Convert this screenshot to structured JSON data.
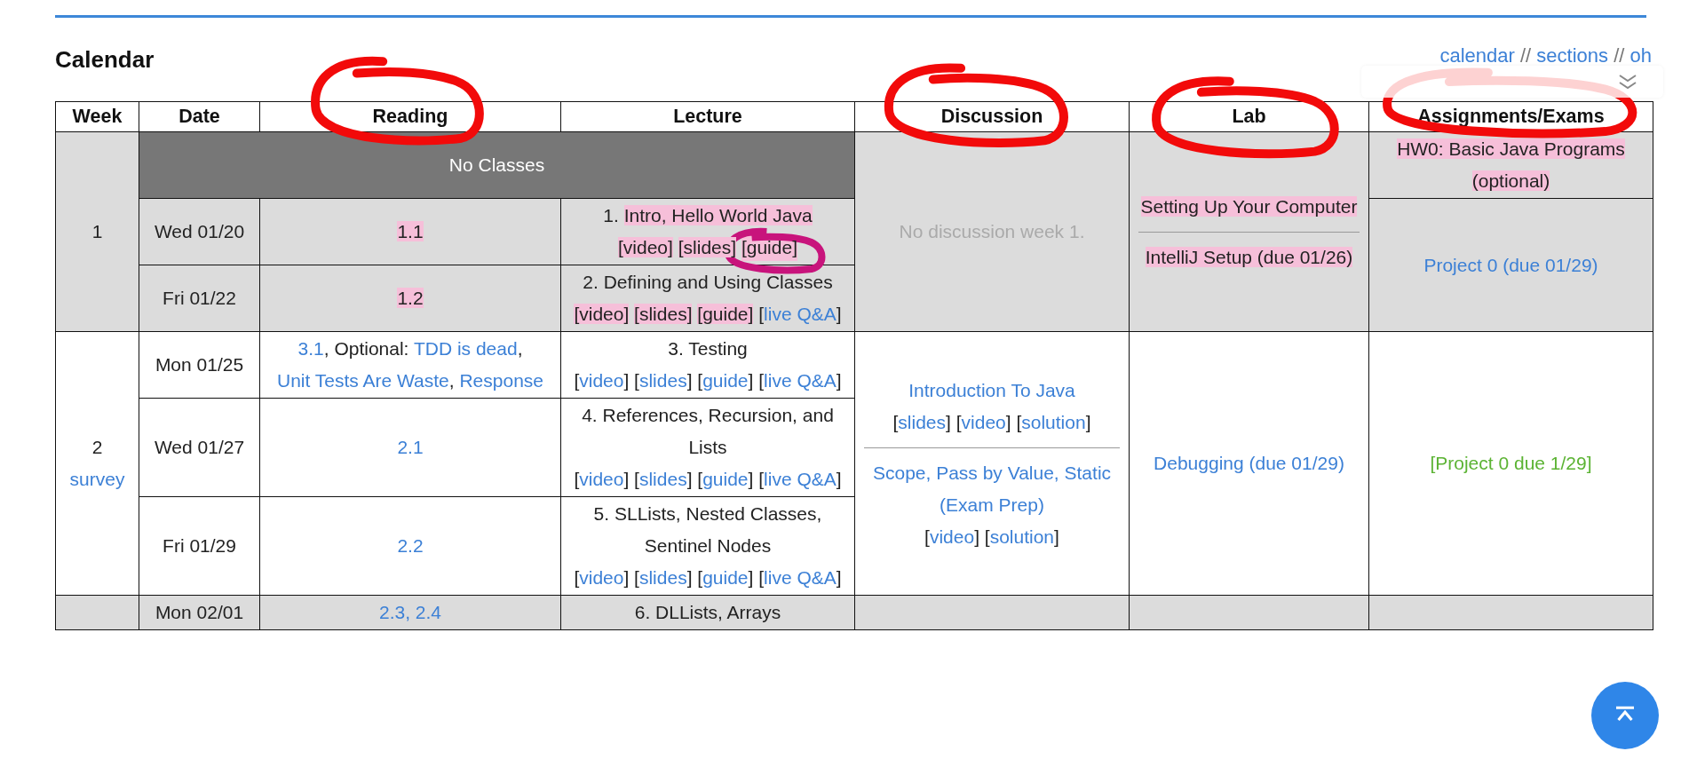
{
  "page": {
    "title": "Calendar",
    "nav": [
      {
        "text": "calendar",
        "kind": "link"
      },
      {
        "text": " // ",
        "kind": "text"
      },
      {
        "text": "sections",
        "kind": "link"
      },
      {
        "text": " // ",
        "kind": "text"
      },
      {
        "text": "oh",
        "kind": "link"
      }
    ]
  },
  "table": {
    "columns": [
      {
        "label": "Week",
        "circled": false
      },
      {
        "label": "Date",
        "circled": false
      },
      {
        "label": "Reading",
        "circled": true
      },
      {
        "label": "Lecture",
        "circled": false
      },
      {
        "label": "Discussion",
        "circled": true
      },
      {
        "label": "Lab",
        "circled": true
      },
      {
        "label": "Assignments/Exams",
        "circled": true
      }
    ],
    "weeks": [
      {
        "shaded": true,
        "week": [
          {
            "kind": "text",
            "parts": [
              {
                "text": "1",
                "kind": "text"
              }
            ]
          }
        ],
        "banner": "No Classes",
        "days": [
          {
            "date": "Wed 01/20",
            "reading": [
              {
                "kind": "text",
                "parts": [
                  {
                    "text": "1.1",
                    "kind": "marked"
                  }
                ]
              }
            ],
            "lecture": [
              {
                "kind": "text",
                "parts": [
                  {
                    "text": "1. ",
                    "kind": "text"
                  },
                  {
                    "text": "Intro, Hello World Java",
                    "kind": "marked"
                  }
                ]
              },
              {
                "kind": "text",
                "parts": [
                  {
                    "text": "[video]",
                    "kind": "marked"
                  },
                  {
                    "text": "[slides]",
                    "kind": "marked"
                  },
                  {
                    "text": "[guide]",
                    "kind": "circled"
                  }
                ]
              }
            ]
          },
          {
            "date": "Fri 01/22",
            "reading": [
              {
                "kind": "text",
                "parts": [
                  {
                    "text": "1.2",
                    "kind": "marked"
                  }
                ]
              }
            ],
            "lecture": [
              {
                "kind": "text",
                "parts": [
                  {
                    "text": "2. Defining and Using Classes",
                    "kind": "text"
                  }
                ]
              },
              {
                "kind": "text",
                "parts": [
                  {
                    "text": "[video]",
                    "kind": "marked"
                  },
                  {
                    "text": "[slides]",
                    "kind": "marked"
                  },
                  {
                    "text": "[guide]",
                    "kind": "marked"
                  },
                  {
                    "text": "[",
                    "kind": "text"
                  },
                  {
                    "text": "live Q&A",
                    "kind": "link"
                  },
                  {
                    "text": "]",
                    "kind": "text"
                  }
                ]
              }
            ]
          }
        ],
        "discussion": [
          {
            "kind": "text",
            "parts": [
              {
                "text": "No discussion week 1.",
                "kind": "muted"
              }
            ]
          }
        ],
        "lab": [
          {
            "kind": "text",
            "parts": [
              {
                "text": "Setting Up Your Computer",
                "kind": "marked"
              }
            ]
          },
          {
            "kind": "rule"
          },
          {
            "kind": "text",
            "parts": [
              {
                "text": "IntelliJ Setup (due 01/26)",
                "kind": "marked"
              }
            ]
          }
        ],
        "assignments": [
          [
            {
              "kind": "text",
              "parts": [
                {
                  "text": "HW0: Basic Java Programs (optional)",
                  "kind": "marked"
                }
              ]
            }
          ],
          [
            {
              "kind": "text",
              "parts": [
                {
                  "text": "Project 0 (due 01/29)",
                  "kind": "link"
                }
              ]
            }
          ]
        ]
      },
      {
        "shaded": false,
        "week": [
          {
            "kind": "text",
            "parts": [
              {
                "text": "2",
                "kind": "text"
              }
            ]
          },
          {
            "kind": "text",
            "parts": [
              {
                "text": "survey",
                "kind": "link"
              }
            ]
          }
        ],
        "days": [
          {
            "date": "Mon 01/25",
            "reading": [
              {
                "kind": "text",
                "parts": [
                  {
                    "text": "3.1",
                    "kind": "link"
                  },
                  {
                    "text": ", Optional: ",
                    "kind": "text"
                  },
                  {
                    "text": "TDD is dead",
                    "kind": "link"
                  },
                  {
                    "text": ", ",
                    "kind": "text"
                  },
                  {
                    "text": "Unit Tests Are Waste",
                    "kind": "link"
                  },
                  {
                    "text": ", ",
                    "kind": "text"
                  },
                  {
                    "text": "Response",
                    "kind": "link"
                  }
                ]
              }
            ],
            "lecture": [
              {
                "kind": "text",
                "parts": [
                  {
                    "text": "3. Testing",
                    "kind": "text"
                  }
                ]
              },
              {
                "kind": "text",
                "parts": [
                  {
                    "text": "[",
                    "kind": "text"
                  },
                  {
                    "text": "video",
                    "kind": "link"
                  },
                  {
                    "text": "] [",
                    "kind": "text"
                  },
                  {
                    "text": "slides",
                    "kind": "link"
                  },
                  {
                    "text": "] [",
                    "kind": "text"
                  },
                  {
                    "text": "guide",
                    "kind": "link"
                  },
                  {
                    "text": "] [",
                    "kind": "text"
                  },
                  {
                    "text": "live Q&A",
                    "kind": "link"
                  },
                  {
                    "text": "]",
                    "kind": "text"
                  }
                ]
              }
            ]
          },
          {
            "date": "Wed 01/27",
            "reading": [
              {
                "kind": "text",
                "parts": [
                  {
                    "text": "2.1",
                    "kind": "link"
                  }
                ]
              }
            ],
            "lecture": [
              {
                "kind": "text",
                "parts": [
                  {
                    "text": "4. References, Recursion, and Lists",
                    "kind": "text"
                  }
                ]
              },
              {
                "kind": "text",
                "parts": [
                  {
                    "text": "[",
                    "kind": "text"
                  },
                  {
                    "text": "video",
                    "kind": "link"
                  },
                  {
                    "text": "] [",
                    "kind": "text"
                  },
                  {
                    "text": "slides",
                    "kind": "link"
                  },
                  {
                    "text": "] [",
                    "kind": "text"
                  },
                  {
                    "text": "guide",
                    "kind": "link"
                  },
                  {
                    "text": "] [",
                    "kind": "text"
                  },
                  {
                    "text": "live Q&A",
                    "kind": "link"
                  },
                  {
                    "text": "]",
                    "kind": "text"
                  }
                ]
              }
            ]
          },
          {
            "date": "Fri 01/29",
            "reading": [
              {
                "kind": "text",
                "parts": [
                  {
                    "text": "2.2",
                    "kind": "link"
                  }
                ]
              }
            ],
            "lecture": [
              {
                "kind": "text",
                "parts": [
                  {
                    "text": "5. SLLists, Nested Classes, Sentinel Nodes",
                    "kind": "text"
                  }
                ]
              },
              {
                "kind": "text",
                "parts": [
                  {
                    "text": "[",
                    "kind": "text"
                  },
                  {
                    "text": "video",
                    "kind": "link"
                  },
                  {
                    "text": "] [",
                    "kind": "text"
                  },
                  {
                    "text": "slides",
                    "kind": "link"
                  },
                  {
                    "text": "] [",
                    "kind": "text"
                  },
                  {
                    "text": "guide",
                    "kind": "link"
                  },
                  {
                    "text": "] [",
                    "kind": "text"
                  },
                  {
                    "text": "live Q&A",
                    "kind": "link"
                  },
                  {
                    "text": "]",
                    "kind": "text"
                  }
                ]
              }
            ]
          }
        ],
        "discussion": [
          {
            "kind": "text",
            "parts": [
              {
                "text": "Introduction To Java",
                "kind": "link"
              }
            ]
          },
          {
            "kind": "text",
            "parts": [
              {
                "text": "[",
                "kind": "text"
              },
              {
                "text": "slides",
                "kind": "link"
              },
              {
                "text": "] [",
                "kind": "text"
              },
              {
                "text": "video",
                "kind": "link"
              },
              {
                "text": "] [",
                "kind": "text"
              },
              {
                "text": "solution",
                "kind": "link"
              },
              {
                "text": "]",
                "kind": "text"
              }
            ]
          },
          {
            "kind": "rule"
          },
          {
            "kind": "text",
            "parts": [
              {
                "text": "Scope, Pass by Value, Static",
                "kind": "link"
              }
            ]
          },
          {
            "kind": "text",
            "parts": [
              {
                "text": "(Exam Prep)",
                "kind": "link"
              }
            ]
          },
          {
            "kind": "text",
            "parts": [
              {
                "text": "[",
                "kind": "text"
              },
              {
                "text": "video",
                "kind": "link"
              },
              {
                "text": "] [",
                "kind": "text"
              },
              {
                "text": "solution",
                "kind": "link"
              },
              {
                "text": "]",
                "kind": "text"
              }
            ]
          }
        ],
        "lab": [
          {
            "kind": "text",
            "parts": [
              {
                "text": "Debugging (due 01/29)",
                "kind": "link"
              }
            ]
          }
        ],
        "assignments": [
          [
            {
              "kind": "text",
              "parts": [
                {
                  "text": "[Project 0 due 1/29]",
                  "kind": "status"
                }
              ]
            }
          ]
        ]
      },
      {
        "shaded": true,
        "days": [
          {
            "date": "Mon 02/01",
            "reading": [
              {
                "kind": "text",
                "parts": [
                  {
                    "text": "2.3, 2.4",
                    "kind": "link"
                  }
                ]
              }
            ],
            "lecture": [
              {
                "kind": "text",
                "parts": [
                  {
                    "text": "6. DLLists, Arrays",
                    "kind": "text"
                  }
                ]
              }
            ]
          }
        ]
      }
    ]
  }
}
